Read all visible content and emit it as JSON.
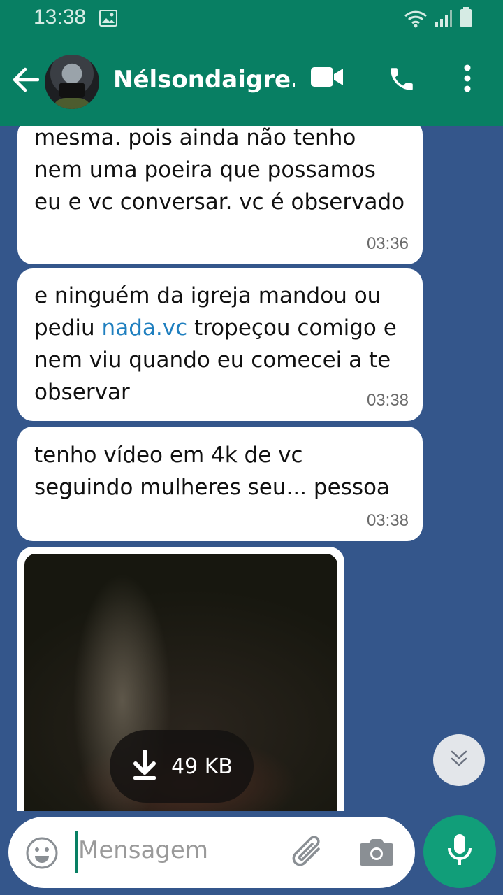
{
  "status_bar": {
    "time": "13:38"
  },
  "header": {
    "contact_name": "Nélsondaigre..."
  },
  "messages": [
    {
      "text_parts": [
        "mesma. pois ainda não  tenho nem uma poeira que  possamos eu e vc conversar.  vc é observado"
      ],
      "time": "03:36"
    },
    {
      "text_before": "e ninguém da igreja mandou ou pediu ",
      "link": "nada.vc",
      "text_after": " tropeçou comigo e nem viu quando eu comecei a te observar",
      "time": "03:38"
    },
    {
      "text": "tenho vídeo em 4k de vc seguindo mulheres seu... pessoa",
      "time": "03:38"
    }
  ],
  "media": {
    "size": "49 KB"
  },
  "composer": {
    "placeholder": "Mensagem"
  },
  "icons": [
    "back-arrow-icon",
    "video-call-icon",
    "phone-icon",
    "more-vert-icon",
    "emoji-icon",
    "attach-icon",
    "camera-icon",
    "mic-icon",
    "download-icon",
    "chevron-double-down-icon"
  ],
  "colors": {
    "header": "#087f63",
    "background": "#34568b",
    "link": "#1f7fbf",
    "mic_button": "#119e79"
  }
}
